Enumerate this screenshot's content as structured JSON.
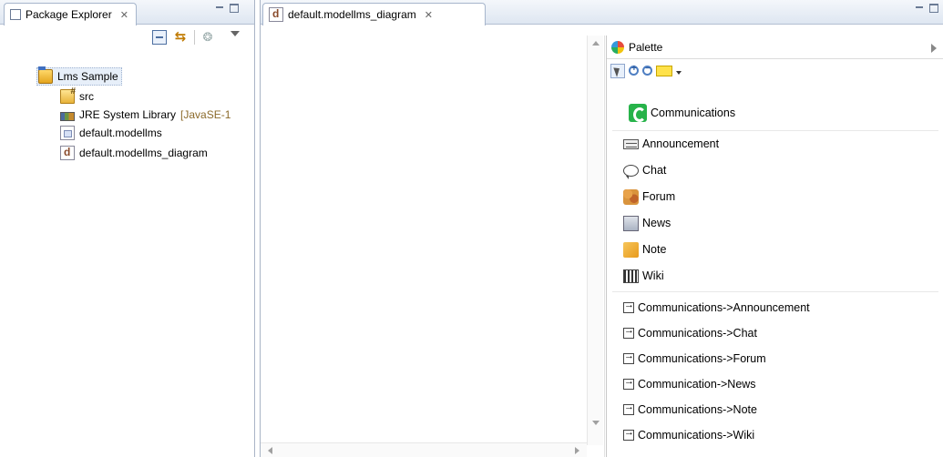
{
  "package_explorer": {
    "tab_label": "Package Explorer",
    "close_symbol": "✕",
    "tree": [
      {
        "label": "Lms Sample",
        "icon": "project-icon",
        "decoration": ""
      },
      {
        "label": "src",
        "icon": "source-folder-icon",
        "decoration": ""
      },
      {
        "label": "JRE System Library",
        "icon": "library-icon",
        "decoration": "[JavaSE-1"
      },
      {
        "label": "default.modellms",
        "icon": "model-file-icon",
        "decoration": ""
      },
      {
        "label": "default.modellms_diagram",
        "icon": "diagram-file-icon",
        "decoration": ""
      }
    ]
  },
  "editor": {
    "tab_label": "default.modellms_diagram",
    "close_symbol": "✕"
  },
  "palette": {
    "title": "Palette",
    "tools": [
      "select-tool-icon",
      "zoom-in-icon",
      "zoom-out-icon",
      "note-tool-icon",
      "dropdown-arrow-icon"
    ],
    "groups": [
      {
        "label": "Communications",
        "icon": "communications-icon"
      }
    ],
    "nodes": [
      {
        "label": "Announcement",
        "icon": "announcement-icon"
      },
      {
        "label": "Chat",
        "icon": "chat-icon"
      },
      {
        "label": "Forum",
        "icon": "forum-icon"
      },
      {
        "label": "News",
        "icon": "news-icon"
      },
      {
        "label": "Note",
        "icon": "note-icon"
      },
      {
        "label": "Wiki",
        "icon": "wiki-icon"
      }
    ],
    "links": [
      {
        "label": "Communications->Announcement",
        "icon": "link-icon"
      },
      {
        "label": "Communications->Chat",
        "icon": "link-icon"
      },
      {
        "label": "Communications->Forum",
        "icon": "link-icon"
      },
      {
        "label": "Communication->News",
        "icon": "link-icon"
      },
      {
        "label": "Communications->Note",
        "icon": "link-icon"
      },
      {
        "label": "Communications->Wiki",
        "icon": "link-icon"
      }
    ]
  },
  "colors": {
    "tab_bar_top": "#f4f7fb",
    "tab_bar_bottom": "#dee6f1",
    "selection": "#e7eff9",
    "communications_green": "#27b34a",
    "decoration_text": "#8b6a2a"
  }
}
